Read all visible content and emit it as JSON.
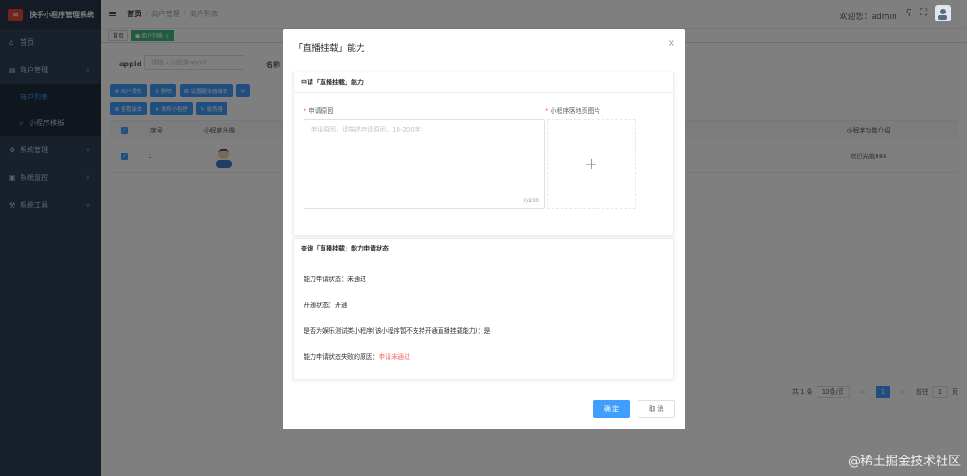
{
  "app": {
    "title": "快手小程序管理系统",
    "logo": "∞"
  },
  "sidebar": {
    "items": [
      {
        "icon": "⌂",
        "icon_name": "dashboard-icon",
        "label": "首页"
      },
      {
        "icon": "▤",
        "icon_name": "user-icon",
        "label": "商户管理",
        "arrow": "∧"
      },
      {
        "label": "商户列表",
        "active": true
      },
      {
        "icon": "☆",
        "icon_name": "template-icon",
        "label": "小程序模板"
      },
      {
        "icon": "⚙",
        "icon_name": "system-icon",
        "label": "系统管理",
        "arrow": "∨"
      },
      {
        "icon": "▣",
        "icon_name": "monitor-icon",
        "label": "系统监控",
        "arrow": "∨"
      },
      {
        "icon": "⚒",
        "icon_name": "tool-icon",
        "label": "系统工具",
        "arrow": "∨"
      }
    ]
  },
  "header": {
    "hamburger": "≡",
    "breadcrumb": [
      "首页",
      "商户管理",
      "商户列表"
    ],
    "welcome": "欢迎您：admin",
    "search_icon": "⚲",
    "fullscreen_icon": "⛶"
  },
  "tags": [
    "首页",
    "● 商户列表 ×"
  ],
  "background": {
    "appid_label": "appid",
    "appid_placeholder": "请输入小程序appid",
    "name_label": "名称",
    "buttons_row1": [
      "⊕ 商户授权",
      "⊖ 删除",
      "⊞ 设置服务器域名",
      "⊟"
    ],
    "buttons_row2": [
      "⊞ 查看版本",
      "➤ 发布小程序",
      "✎ 服务器"
    ],
    "table_headers": [
      "序号",
      "小程序头像",
      "小程序功能介绍"
    ],
    "table_row": {
      "index": "1",
      "intro": "欢迎光临888"
    },
    "pager": {
      "total": "共 1 条",
      "size": "10条/页",
      "prev": "<",
      "current": "1",
      "next": ">",
      "goto": "前往",
      "page": "1",
      "unit": "页"
    }
  },
  "dialog": {
    "title": "「直播挂载」能力",
    "close": "×",
    "apply_card": {
      "header": "申请「直播挂载」能力",
      "reason_label": "申请原因",
      "reason_placeholder": "申请原因，请描述申请原因，10-200字",
      "reason_count": "0/200",
      "image_label": "小程序落地页图片",
      "upload_plus": "+"
    },
    "status_card": {
      "header": "查询「直播挂载」能力申请状态",
      "apply_status_label": "能力申请状态：",
      "apply_status_value": "未通过",
      "open_status_label": "开通状态：",
      "open_status_value": "开通",
      "is_test_label": "是否为娱乐测试类小程序(该小程序暂不支持开通直播挂载能力)：",
      "is_test_value": "是",
      "fail_reason_label": "能力申请状态失败的原因：",
      "fail_reason_value": "申请未通过"
    },
    "confirm": "确 定",
    "cancel": "取 消"
  },
  "watermark": "@稀土掘金技术社区"
}
